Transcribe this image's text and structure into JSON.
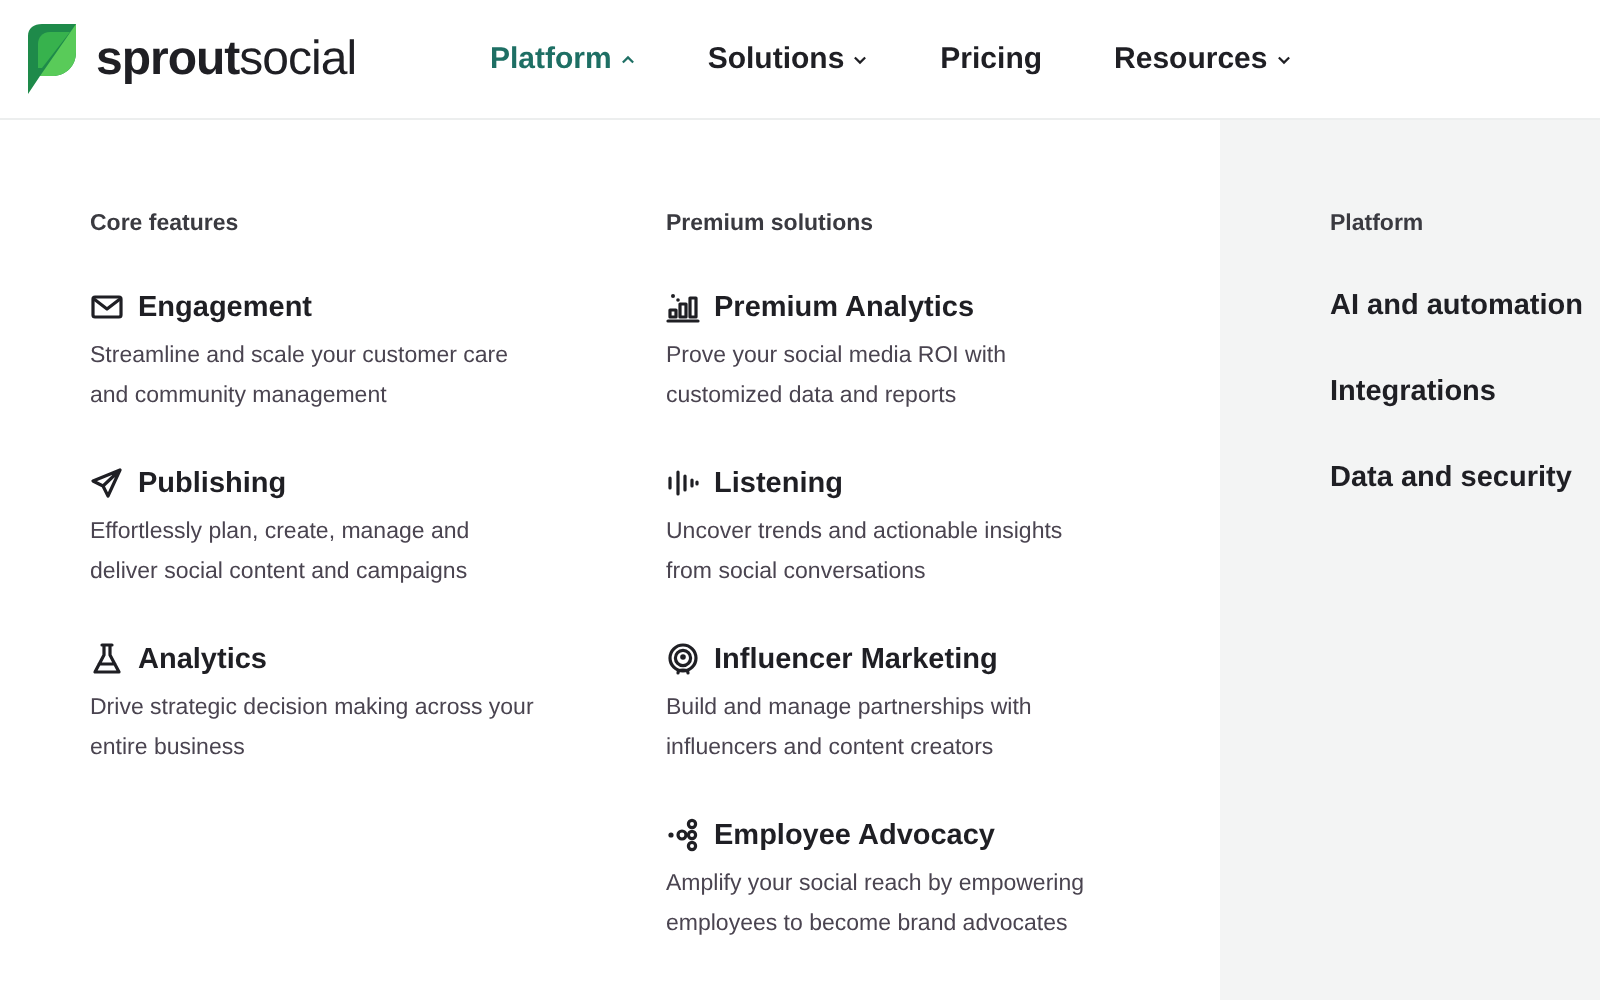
{
  "logo": {
    "text": "**sprout**social"
  },
  "nav": [
    {
      "label": "Platform",
      "kind": "menu",
      "selected": true,
      "expanded": true
    },
    {
      "label": "Solutions",
      "kind": "menu",
      "selected": false,
      "expanded": false
    },
    {
      "label": "Pricing",
      "kind": "link",
      "selected": false
    },
    {
      "label": "Resources",
      "kind": "menu",
      "selected": false,
      "expanded": false
    }
  ],
  "columns": [
    {
      "heading": "Core features",
      "items": [
        {
          "title": "Engagement",
          "description": "Streamline and scale your customer care and community management"
        },
        {
          "title": "Publishing",
          "description": "Effortlessly plan, create, manage and deliver social content and campaigns"
        },
        {
          "title": "Analytics",
          "description": "Drive strategic decision making across your entire business"
        }
      ]
    },
    {
      "heading": "Premium solutions",
      "items": [
        {
          "title": "Premium Analytics",
          "description": "Prove your social media ROI with customized data and reports"
        },
        {
          "title": "Listening",
          "description": "Uncover trends and actionable insights from social conversations"
        },
        {
          "title": "Influencer Marketing",
          "description": "Build and manage partnerships with influencers and content creators"
        },
        {
          "title": "Employee Advocacy",
          "description": "Amplify your social reach by empowering employees to become brand advocates"
        }
      ]
    }
  ],
  "side": {
    "heading": "Platform",
    "links": [
      "AI and automation",
      "Integrations",
      "Data and security"
    ]
  }
}
